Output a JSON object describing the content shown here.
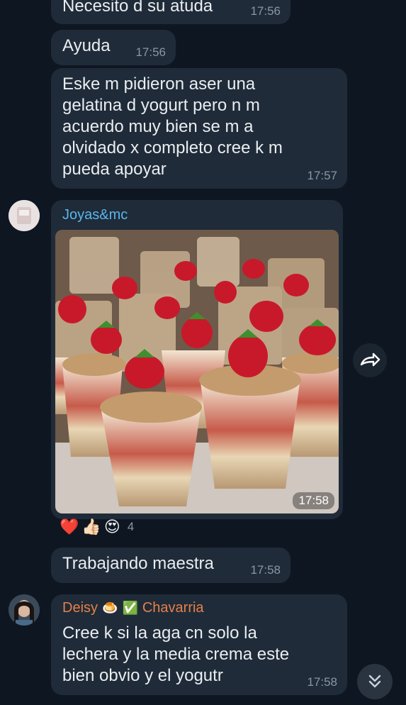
{
  "messages": [
    {
      "text": "Necesito d su atuda",
      "time": "17:56"
    },
    {
      "text": "Ayuda",
      "time": "17:56"
    },
    {
      "text": "Eske m pidieron aser una gelatina d yogurt pero n m acuerdo muy bien se m a olvidado x completo cree k m pueda apoyar",
      "time": "17:57"
    },
    {
      "sender": "Joyas&mc",
      "type": "photo",
      "time": "17:58",
      "reactions": {
        "emoji": [
          "❤️",
          "👍🏻",
          "😍"
        ],
        "count": "4"
      }
    },
    {
      "text": "Trabajando maestra",
      "time": "17:58"
    },
    {
      "sender_parts": [
        "Deisy",
        "🍮",
        "✅",
        "Chavarria"
      ],
      "text": "Cree k si la aga cn solo la lechera y la media crema este bien obvio y el yogutr",
      "time": "17:58"
    }
  ],
  "colors": {
    "background": "#0e1621",
    "bubble": "#1f2b38",
    "sender_blue": "#5bb5ee",
    "sender_orange": "#e5804a"
  },
  "icons": {
    "share": "share-icon",
    "scroll_down": "double-chevron-down-icon"
  }
}
